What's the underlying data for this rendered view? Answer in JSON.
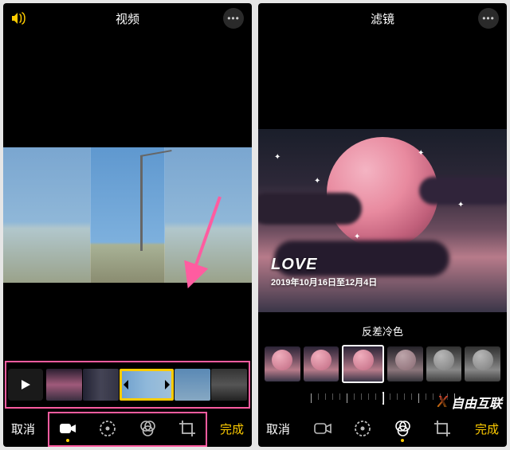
{
  "left": {
    "header": {
      "title": "视频"
    },
    "bottom": {
      "cancel": "取消",
      "done": "完成"
    },
    "tools": [
      "video",
      "adjust",
      "filters",
      "crop"
    ],
    "active_tool_index": 0,
    "timeline": {
      "clips_count": 5,
      "selected_index": 2
    }
  },
  "right": {
    "header": {
      "title": "滤镜"
    },
    "preview": {
      "title": "LOVE",
      "date_range": "2019年10月16日至12月4日"
    },
    "filter_name": "反差冷色",
    "filters_count": 6,
    "selected_filter_index": 2,
    "bottom": {
      "cancel": "取消",
      "done": "完成"
    },
    "tools": [
      "video",
      "adjust",
      "filters",
      "crop"
    ],
    "active_tool_index": 2
  },
  "annotations": {
    "boxes": [
      "timeline-highlight",
      "toolbar-highlight"
    ],
    "arrow": true
  },
  "watermark": "自由互联"
}
